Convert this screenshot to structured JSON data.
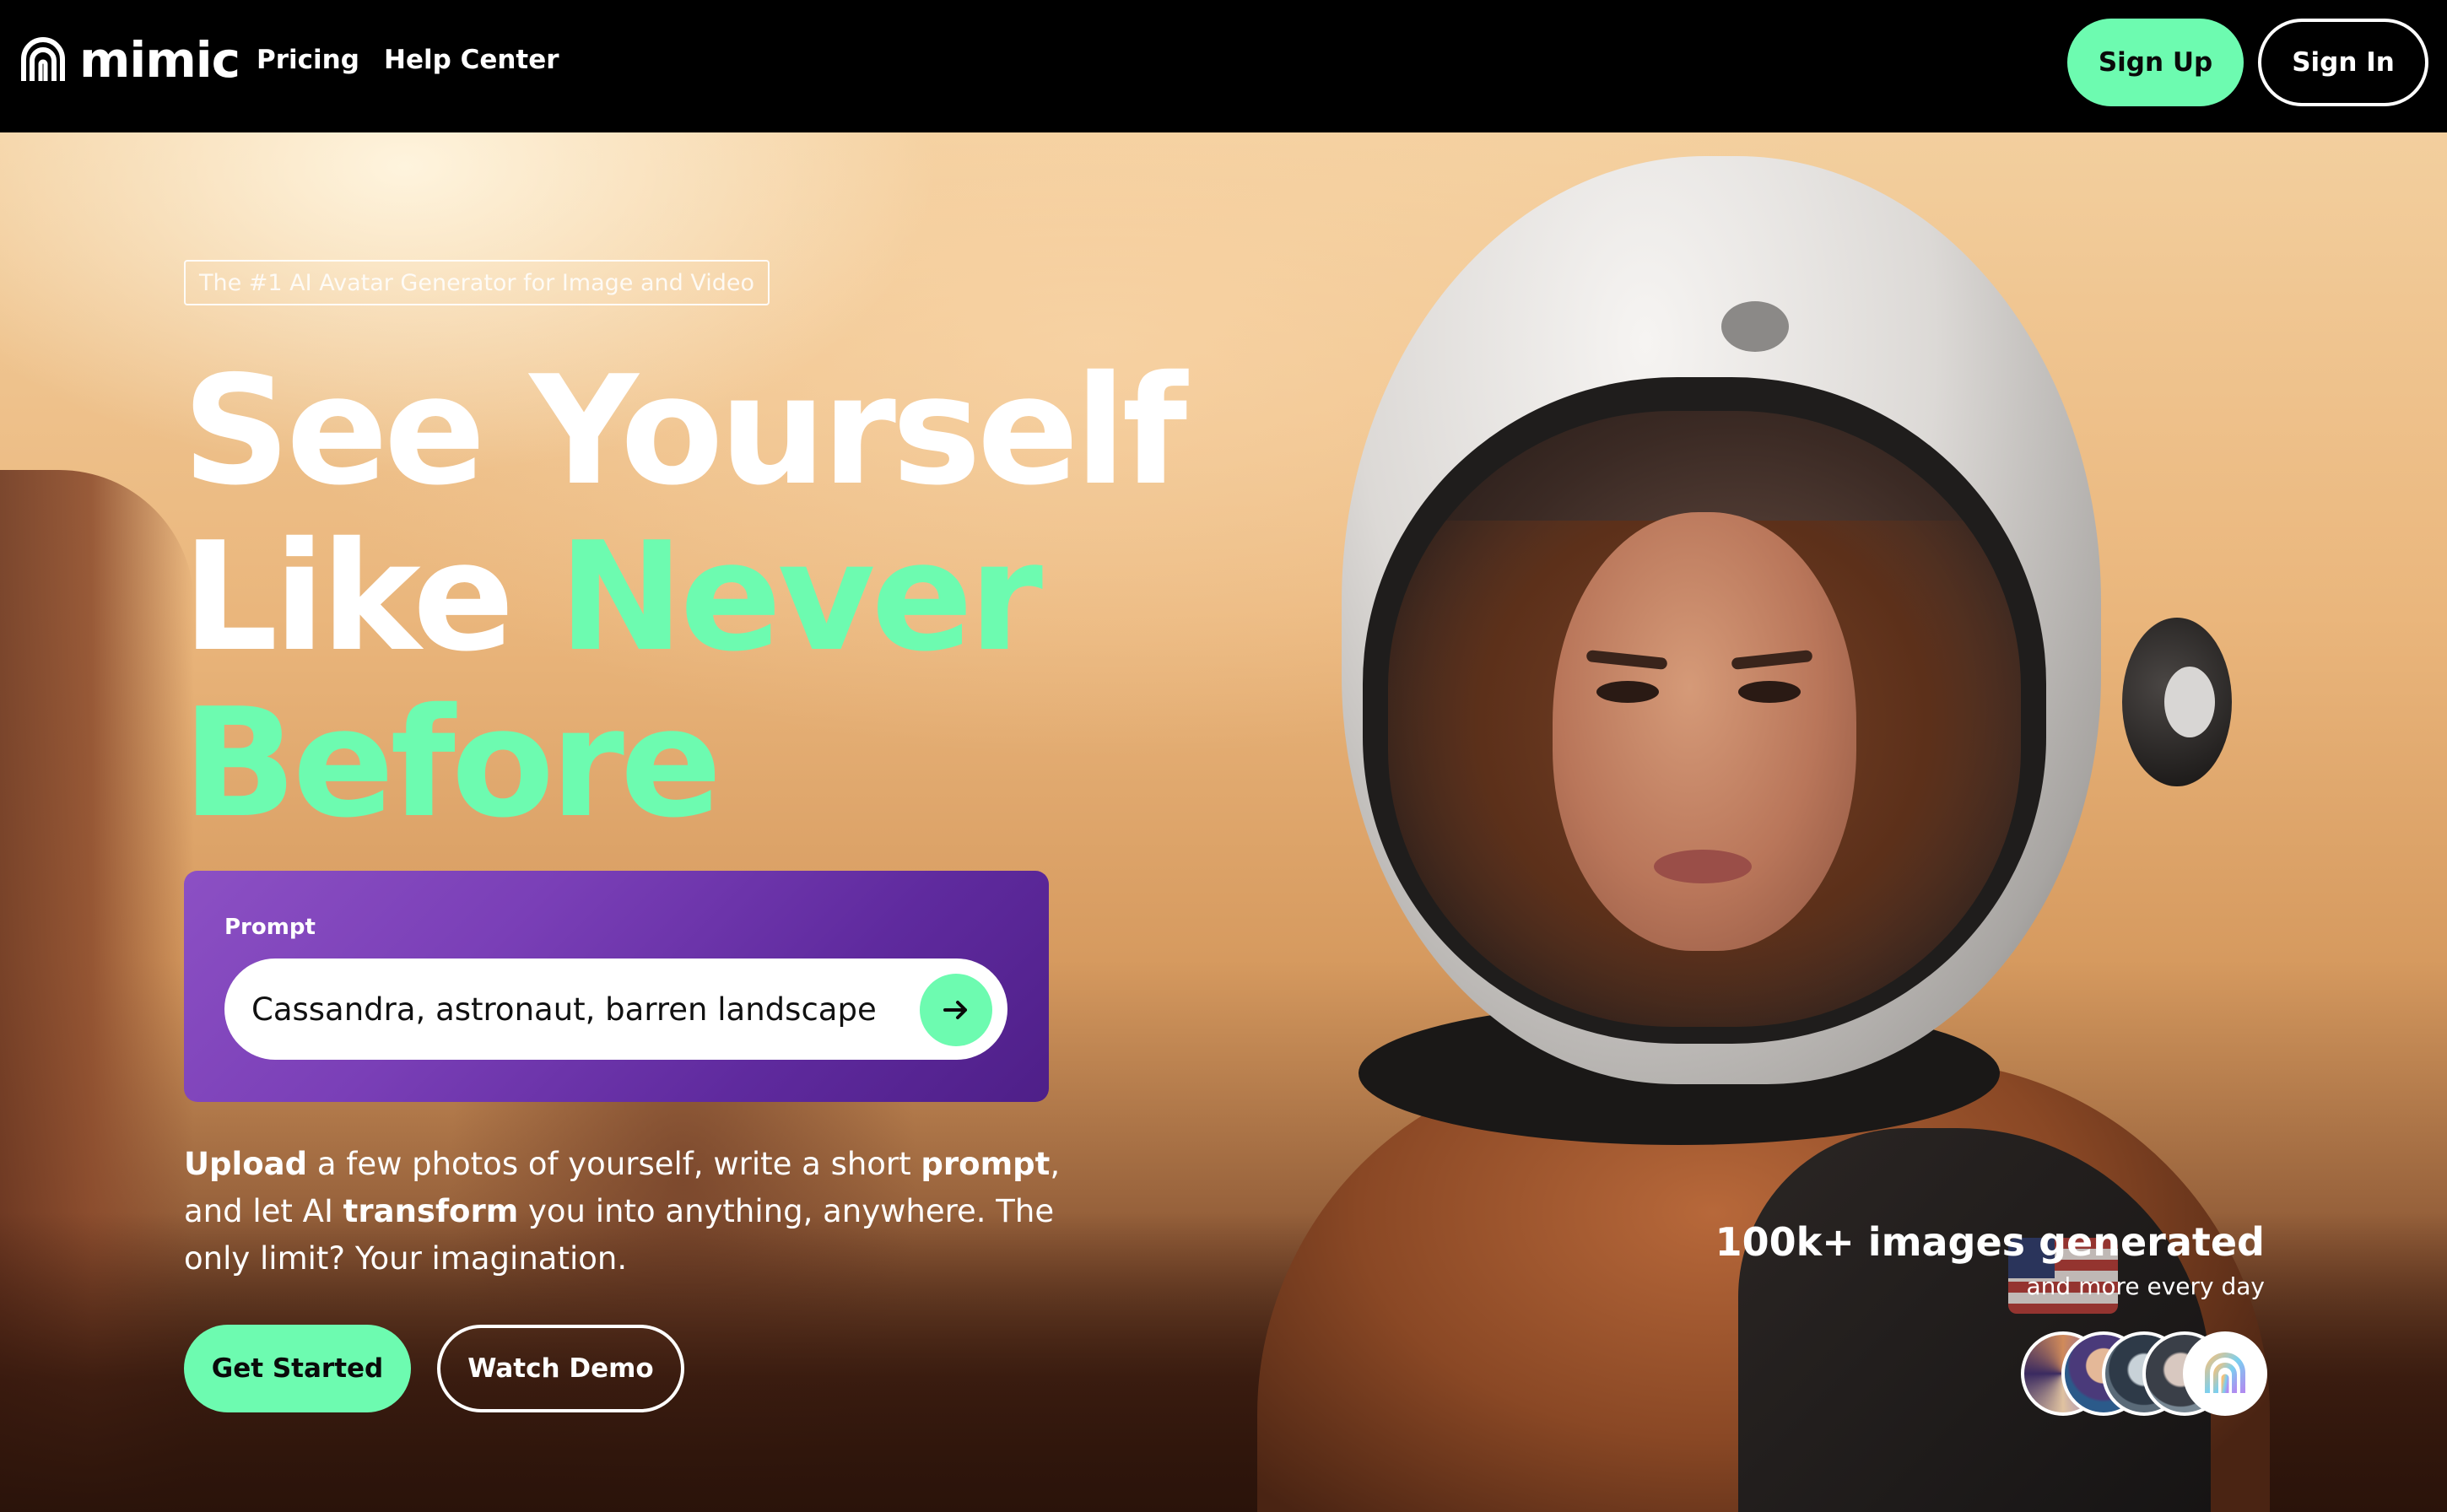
{
  "nav": {
    "brand": "mimic",
    "links": [
      "Pricing",
      "Help Center"
    ],
    "signup_label": "Sign Up",
    "signin_label": "Sign In"
  },
  "hero": {
    "tagline": "The #1 AI Avatar Generator for Image and Video",
    "headline_line1": "See Yourself",
    "headline_line2_white": "Like ",
    "headline_line2_accent": "Never",
    "headline_line3_accent": "Before",
    "prompt": {
      "label": "Prompt",
      "value": "Cassandra, astronaut, barren landscape"
    },
    "description": {
      "w1": "Upload",
      "t1": " a few photos of yourself, write a short ",
      "w2": "prompt",
      "t2": ", and let AI ",
      "w3": "transform",
      "t3": " you into anything, anywhere. The only limit? Your imagination."
    },
    "primary_cta": "Get Started",
    "secondary_cta": "Watch Demo"
  },
  "stats": {
    "headline": "100k+ images generated",
    "subline": "and more every day"
  },
  "colors": {
    "accent": "#6dfbb0",
    "nav_bg": "#000000",
    "prompt_card": "#7a3fb7"
  },
  "icons": {
    "logo": "mimic-logo-icon",
    "submit": "arrow-right-icon"
  }
}
